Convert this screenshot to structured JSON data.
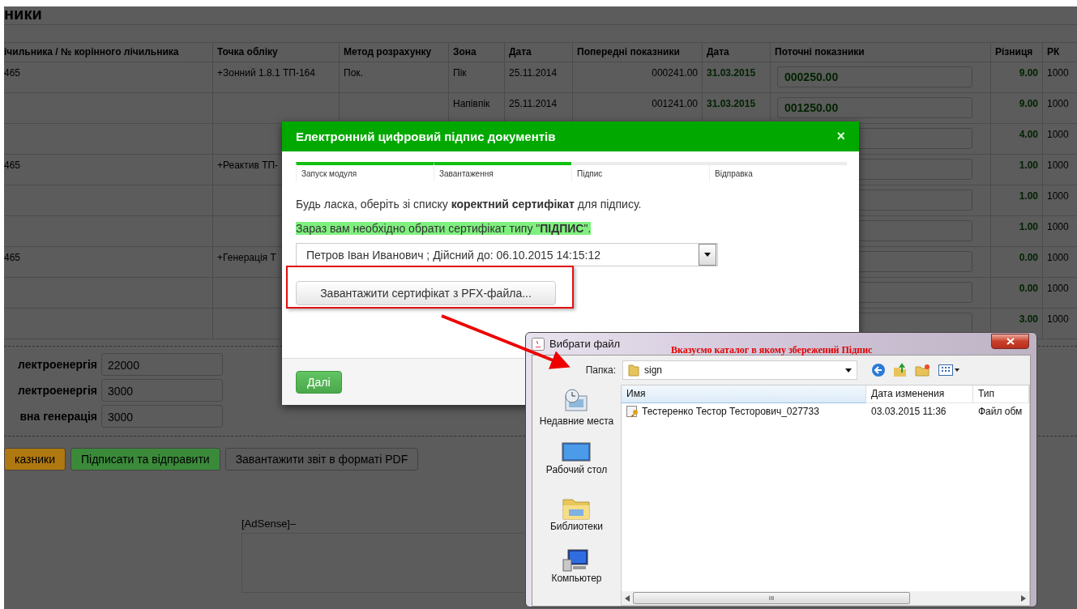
{
  "page": {
    "title": "ники",
    "table": {
      "columns": [
        "ічильника / № корінного лічильника",
        "Точка обліку",
        "Метод розрахунку",
        "Зона",
        "Дата",
        "Попередні показники",
        "Дата",
        "Поточні показники",
        "Різниця",
        "РК"
      ],
      "rows": [
        {
          "meter": "465",
          "point": "+Зонний 1.8.1 ТП-164",
          "method": "Пок.",
          "zone": "Пік",
          "prev_date": "25.11.2014",
          "prev": "000241.00",
          "date": "31.03.2015",
          "current": "000250.00",
          "diff": "9.00",
          "rk": "1000"
        },
        {
          "zone": "Напівпік",
          "prev_date": "25.11.2014",
          "prev": "001241.00",
          "date": "31.03.2015",
          "current": "001250.00",
          "diff": "9.00",
          "rk": "1000"
        },
        {
          "diff": "4.00",
          "rk": "1000"
        },
        {
          "meter": "465",
          "point": "+Реактив ТП-",
          "diff": "1.00",
          "rk": "1000"
        },
        {
          "diff": "1.00",
          "rk": "1000"
        },
        {
          "diff": "1.00",
          "rk": "1000"
        },
        {
          "meter": "465",
          "point": "+Генерація Т",
          "diff": "0.00",
          "rk": "1000"
        },
        {
          "diff": "0.00",
          "rk": "1000"
        },
        {
          "diff": "3.00",
          "rk": "1000"
        }
      ]
    },
    "totals": [
      {
        "label": "лектроенергія",
        "value": "22000"
      },
      {
        "label": "лектроенергія",
        "value": "3000"
      },
      {
        "label": "вна генерація",
        "value": "3000"
      }
    ],
    "buttons": [
      {
        "label": "казники",
        "kind": "warning"
      },
      {
        "label": "Підписати та відправити",
        "kind": "success"
      },
      {
        "label": "Завантажити звіт в форматі PDF",
        "kind": "default"
      }
    ],
    "ad_label": "[AdSense]–"
  },
  "sign_modal": {
    "title": "Електронний цифровий підпис документів",
    "close": "×",
    "steps": [
      {
        "label": "Запуск модуля",
        "done": true
      },
      {
        "label": "Завантаження",
        "done": true
      },
      {
        "label": "Підпис",
        "done": false
      },
      {
        "label": "Відправка",
        "done": false
      }
    ],
    "instruction": "Будь ласка, оберіть зі списку **коректний сертифікат** для підпису.",
    "notice": "Зараз вам необхідно обрати сертифікат типу \"**ПІДПИС**\".",
    "certificate_select": {
      "value": "Петров Іван Иванович ; Дійсний до: 06.10.2015 14:15:12"
    },
    "load_pfx_button": "Завантажити сертифікат з PFX-файла...",
    "next_button": "Далі"
  },
  "file_dialog": {
    "title": "Вибрати файл",
    "folder_label": "Папка:",
    "folder": "sign",
    "places": [
      {
        "label": "Недавние места",
        "kind": "recent"
      },
      {
        "label": "Рабочий стол",
        "kind": "desktop"
      },
      {
        "label": "Библиотеки",
        "kind": "libraries"
      },
      {
        "label": "Компьютер",
        "kind": "computer"
      }
    ],
    "columns": [
      "Имя",
      "Дата изменения",
      "Тип"
    ],
    "files": [
      {
        "name": "Тестеренко Тестор Тесторович_027733",
        "modified": "03.03.2015 11:36",
        "type": "Файл обм"
      }
    ],
    "scroll_grip": "III"
  },
  "annotation": {
    "text": "Вказуємо каталог в якому збережений Підпис"
  }
}
